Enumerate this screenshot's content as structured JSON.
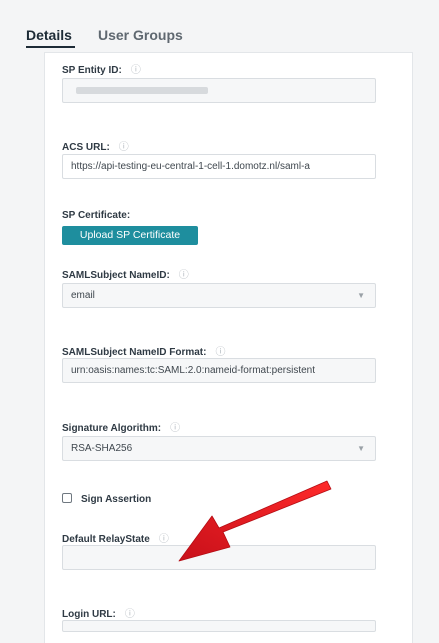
{
  "tabs": [
    {
      "label": "Details",
      "active": true
    },
    {
      "label": "User Groups",
      "active": false
    }
  ],
  "fields": {
    "sp_entity_id": {
      "label": "SP Entity ID:",
      "value": ""
    },
    "acs_url": {
      "label": "ACS URL:",
      "value": "https://api-testing-eu-central-1-cell-1.domotz.nl/saml-a"
    },
    "sp_certificate": {
      "label": "SP Certificate:",
      "button": "Upload SP Certificate"
    },
    "saml_subject_nameid": {
      "label": "SAMLSubject NameID:",
      "value": "email"
    },
    "saml_subject_nameid_format": {
      "label": "SAMLSubject NameID Format:",
      "value": "urn:oasis:names:tc:SAML:2.0:nameid-format:persistent"
    },
    "signature_algorithm": {
      "label": "Signature Algorithm:",
      "value": "RSA-SHA256"
    },
    "sign_assertion": {
      "label": "Sign Assertion",
      "checked": false
    },
    "default_relaystate": {
      "label": "Default RelayState",
      "value": ""
    },
    "login_url": {
      "label": "Login URL:",
      "value": ""
    }
  },
  "icons": {
    "info": "info-icon",
    "dropdown": "chevron-down-icon",
    "annotation": "red-arrow"
  },
  "colors": {
    "accent": "#1e8e9e",
    "annotation": "#e0181f"
  }
}
